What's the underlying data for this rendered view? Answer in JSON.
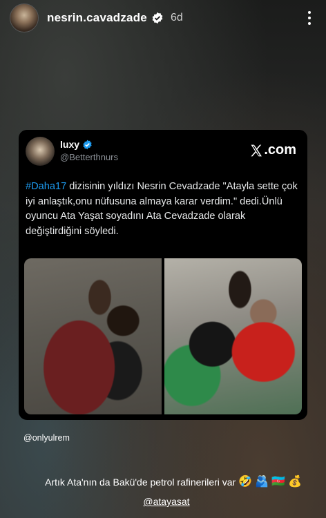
{
  "header": {
    "username": "nesrin.cavadzade",
    "time": "6d"
  },
  "tweet": {
    "name": "luxy",
    "handle": "@Betterthnurs",
    "source": ".com",
    "hashtag": "#Daha17",
    "text": " dizisinin yıldızı Nesrin Cevadzade \"Atayla sette çok iyi anlaştık,onu nüfusuna almaya karar verdim.\" dedi.Ünlü oyuncu Ata Yaşat soyadını Ata Cevadzade olarak değiştirdiğini söyledi."
  },
  "story": {
    "credit": "@onlyulrem",
    "caption": "Artık Ata'nın da Bakü'de petrol rafinerileri var",
    "emojis": [
      "🤣",
      "🫂",
      "🇦🇿",
      "💰"
    ],
    "mention": "@atayasat"
  }
}
